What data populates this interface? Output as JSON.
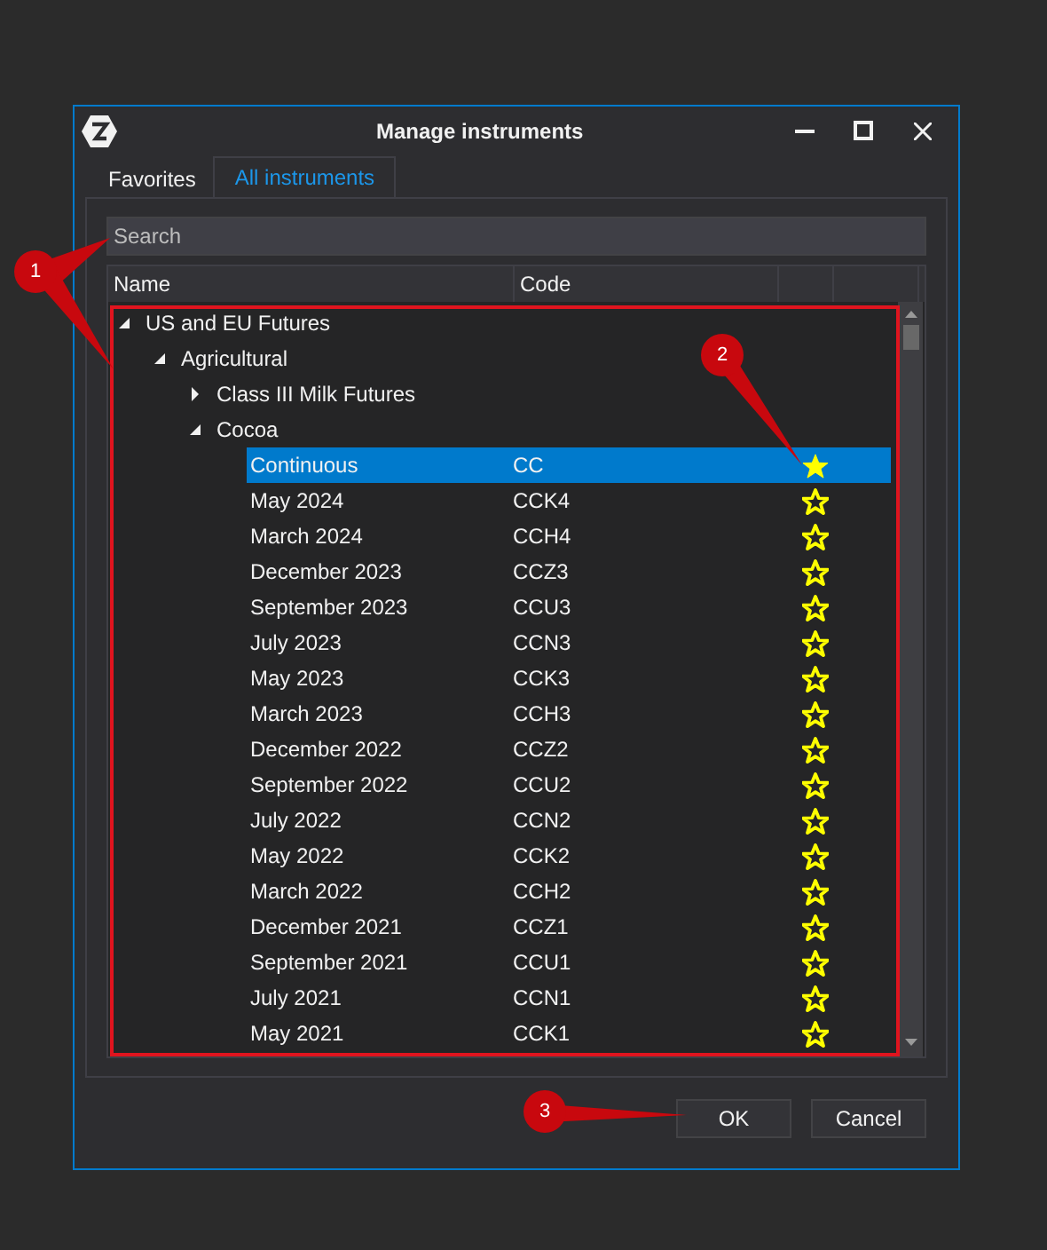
{
  "window": {
    "title": "Manage instruments"
  },
  "tabs": [
    {
      "label": "Favorites",
      "selected": false
    },
    {
      "label": "All instruments",
      "selected": true
    }
  ],
  "search": {
    "placeholder": "Search"
  },
  "table": {
    "columns": [
      "Name",
      "Code"
    ],
    "tree": [
      {
        "name": "US and EU Futures",
        "expanded": true,
        "children": [
          {
            "name": "Agricultural",
            "expanded": true,
            "children": [
              {
                "name": "Class III Milk Futures",
                "expanded": false
              },
              {
                "name": "Cocoa",
                "expanded": true,
                "children": [
                  {
                    "name": "Continuous",
                    "code": "CC",
                    "favorite": true,
                    "selected": true
                  },
                  {
                    "name": "May 2024",
                    "code": "CCK4",
                    "favorite": false,
                    "selected": false
                  },
                  {
                    "name": "March 2024",
                    "code": "CCH4",
                    "favorite": false,
                    "selected": false
                  },
                  {
                    "name": "December 2023",
                    "code": "CCZ3",
                    "favorite": false,
                    "selected": false
                  },
                  {
                    "name": "September 2023",
                    "code": "CCU3",
                    "favorite": false,
                    "selected": false
                  },
                  {
                    "name": "July 2023",
                    "code": "CCN3",
                    "favorite": false,
                    "selected": false
                  },
                  {
                    "name": "May 2023",
                    "code": "CCK3",
                    "favorite": false,
                    "selected": false
                  },
                  {
                    "name": "March 2023",
                    "code": "CCH3",
                    "favorite": false,
                    "selected": false
                  },
                  {
                    "name": "December 2022",
                    "code": "CCZ2",
                    "favorite": false,
                    "selected": false
                  },
                  {
                    "name": "September 2022",
                    "code": "CCU2",
                    "favorite": false,
                    "selected": false
                  },
                  {
                    "name": "July 2022",
                    "code": "CCN2",
                    "favorite": false,
                    "selected": false
                  },
                  {
                    "name": "May 2022",
                    "code": "CCK2",
                    "favorite": false,
                    "selected": false
                  },
                  {
                    "name": "March 2022",
                    "code": "CCH2",
                    "favorite": false,
                    "selected": false
                  },
                  {
                    "name": "December 2021",
                    "code": "CCZ1",
                    "favorite": false,
                    "selected": false
                  },
                  {
                    "name": "September 2021",
                    "code": "CCU1",
                    "favorite": false,
                    "selected": false
                  },
                  {
                    "name": "July 2021",
                    "code": "CCN1",
                    "favorite": false,
                    "selected": false
                  },
                  {
                    "name": "May 2021",
                    "code": "CCK1",
                    "favorite": false,
                    "selected": false
                  }
                ]
              }
            ]
          }
        ]
      }
    ]
  },
  "buttons": [
    {
      "label": "OK"
    },
    {
      "label": "Cancel"
    }
  ],
  "annotations": [
    {
      "label": "1"
    },
    {
      "label": "2"
    },
    {
      "label": "3"
    }
  ]
}
